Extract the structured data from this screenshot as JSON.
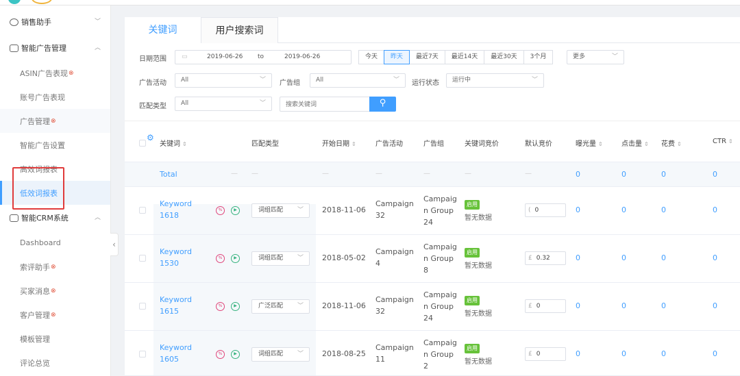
{
  "sidebar": {
    "group1": "销售助手",
    "group2": "智能广告管理",
    "ad_items": [
      {
        "label": "ASIN广告表现",
        "dot": true
      },
      {
        "label": "账号广告表现",
        "dot": false
      },
      {
        "label": "广告管理",
        "dot": true
      },
      {
        "label": "智能广告设置",
        "dot": false
      },
      {
        "label": "高效词报表",
        "dot": false
      },
      {
        "label": "低效词报表",
        "dot": false
      }
    ],
    "group3": "智能CRM系统",
    "crm_items": [
      {
        "label": "Dashboard",
        "dot": false
      },
      {
        "label": "索评助手",
        "dot": true
      },
      {
        "label": "买家消息",
        "dot": true
      },
      {
        "label": "客户管理",
        "dot": true
      },
      {
        "label": "模板管理",
        "dot": false
      },
      {
        "label": "评论总览",
        "dot": false
      }
    ]
  },
  "tabs": [
    "关键词",
    "用户搜索词"
  ],
  "filters": {
    "date_label": "日期范围",
    "date_from": "2019-06-26",
    "date_to_word": "to",
    "date_to": "2019-06-26",
    "quick": [
      "今天",
      "昨天",
      "最近7天",
      "最近14天",
      "最近30天",
      "3个月"
    ],
    "more": "更多",
    "campaign_label": "广告活动",
    "campaign_value": "All",
    "adgroup_label": "广告组",
    "adgroup_value": "All",
    "status_label": "运行状态",
    "status_value": "运行中",
    "match_label": "匹配类型",
    "match_value": "All",
    "search_placeholder": "搜索关键词"
  },
  "table": {
    "headers": {
      "keyword": "关键词",
      "match": "匹配类型",
      "start": "开始日期",
      "campaign": "广告活动",
      "adgroup": "广告组",
      "kw_bid": "关键词竞价",
      "default_bid": "默认竞价",
      "impressions": "曝光量",
      "clicks": "点击量",
      "spend": "花费",
      "ctr": "CTR"
    },
    "total_label": "Total",
    "total_values": [
      "0",
      "0",
      "0",
      "0"
    ],
    "dash": "—",
    "rows": [
      {
        "kw1": "Keyword",
        "kw2": "1618",
        "match": "词组匹配",
        "start": "2018-11-06",
        "camp1": "Campaign",
        "camp2": "32",
        "grp1": "Campaig",
        "grp2": "n Group",
        "grp3": "24",
        "tag": "启用",
        "nodata": "暂无数据",
        "cur": "(",
        "bid": "0",
        "imp": "0",
        "clk": "0",
        "spend": "0",
        "ctr": "0"
      },
      {
        "kw1": "Keyword",
        "kw2": "1530",
        "match": "词组匹配",
        "start": "2018-05-02",
        "camp1": "Campaign",
        "camp2": "4",
        "grp1": "Campaig",
        "grp2": "n Group",
        "grp3": "8",
        "tag": "启用",
        "nodata": "暂无数据",
        "cur": "£",
        "bid": "0.32",
        "imp": "0",
        "clk": "0",
        "spend": "0",
        "ctr": "0"
      },
      {
        "kw1": "Keyword",
        "kw2": "1615",
        "match": "广泛匹配",
        "start": "2018-11-06",
        "camp1": "Campaign",
        "camp2": "32",
        "grp1": "Campaig",
        "grp2": "n Group",
        "grp3": "24",
        "tag": "启用",
        "nodata": "暂无数据",
        "cur": "£",
        "bid": "0",
        "imp": "0",
        "clk": "0",
        "spend": "0",
        "ctr": "0"
      },
      {
        "kw1": "Keyword",
        "kw2": "1605",
        "match": "词组匹配",
        "start": "2018-08-25",
        "camp1": "Campaign",
        "camp2": "11",
        "grp1": "Campaig",
        "grp2": "n Group",
        "grp3": "2",
        "tag": "启用",
        "nodata": "暂无数据",
        "cur": "£",
        "bid": "0",
        "imp": "0",
        "clk": "0",
        "spend": "0",
        "ctr": "0"
      }
    ]
  },
  "colors": {
    "accent": "#409eff",
    "highlight_box": "#e03b3b",
    "tag_green": "#67c23a"
  }
}
